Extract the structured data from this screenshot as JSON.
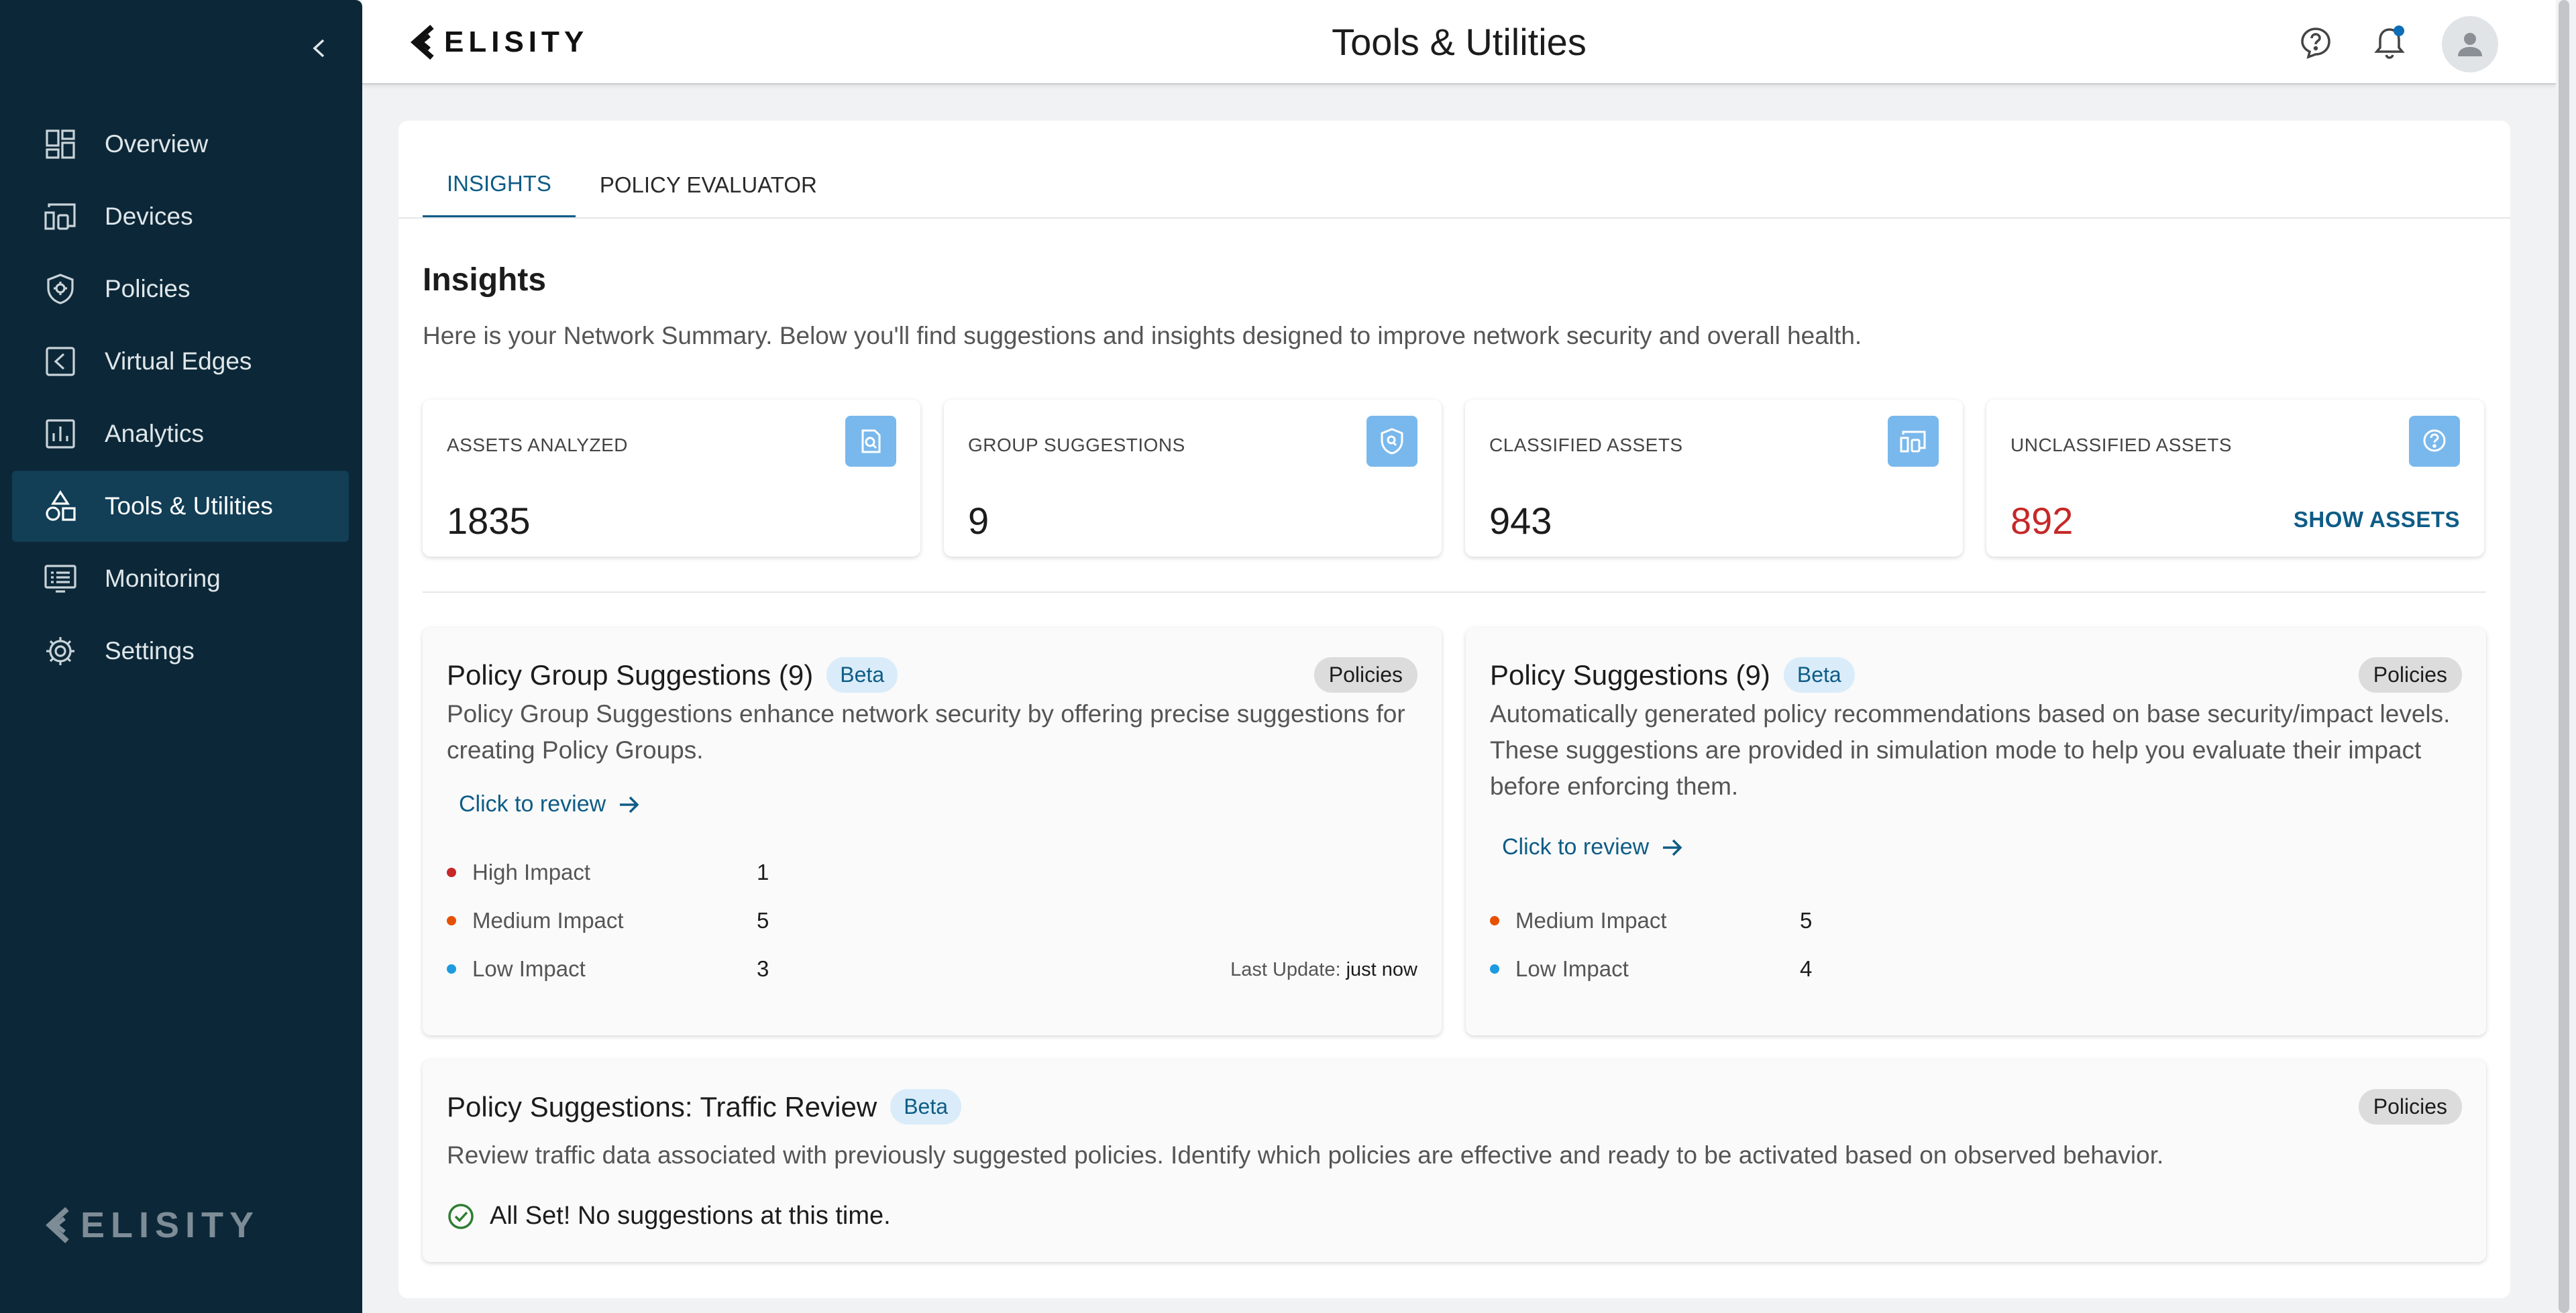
{
  "app": {
    "brand": "ELISITY",
    "page_title": "Tools & Utilities"
  },
  "colors": {
    "sidebar": "#0c2838",
    "accent": "#0e5c86",
    "high": "#c62828",
    "medium": "#e65100",
    "low": "#1e9be0",
    "success": "#2e7d32"
  },
  "sidebar": {
    "items": [
      {
        "label": "Overview",
        "icon": "dashboard-icon"
      },
      {
        "label": "Devices",
        "icon": "devices-icon"
      },
      {
        "label": "Policies",
        "icon": "shield-icon"
      },
      {
        "label": "Virtual Edges",
        "icon": "virtual-edge-icon"
      },
      {
        "label": "Analytics",
        "icon": "bar-chart-icon"
      },
      {
        "label": "Tools & Utilities",
        "icon": "shapes-icon",
        "active": true
      },
      {
        "label": "Monitoring",
        "icon": "monitor-icon"
      },
      {
        "label": "Settings",
        "icon": "gear-icon"
      }
    ],
    "logo": "ELISITY"
  },
  "tabs": [
    {
      "label": "INSIGHTS",
      "active": true
    },
    {
      "label": "POLICY EVALUATOR"
    }
  ],
  "insights": {
    "title": "Insights",
    "description": "Here is your Network Summary. Below you'll find suggestions and insights designed to improve network security and overall health."
  },
  "stats": [
    {
      "label": "ASSETS ANALYZED",
      "value": "1835",
      "icon": "asset-search-icon"
    },
    {
      "label": "GROUP SUGGESTIONS",
      "value": "9",
      "icon": "shield-search-icon"
    },
    {
      "label": "CLASSIFIED ASSETS",
      "value": "943",
      "icon": "devices-icon"
    },
    {
      "label": "UNCLASSIFIED ASSETS",
      "value": "892",
      "icon": "help-circle-icon",
      "action": "SHOW ASSETS"
    }
  ],
  "policy_group_suggestions": {
    "title": "Policy Group Suggestions (9)",
    "badge": "Beta",
    "chip": "Policies",
    "description": "Policy Group Suggestions enhance network security by offering precise suggestions for creating Policy Groups.",
    "review": "Click to review",
    "impacts": [
      {
        "label": "High Impact",
        "value": "1",
        "level": "high"
      },
      {
        "label": "Medium Impact",
        "value": "5",
        "level": "medium"
      },
      {
        "label": "Low Impact",
        "value": "3",
        "level": "low"
      }
    ],
    "last_update_label": "Last Update:",
    "last_update_value": "just now"
  },
  "policy_suggestions": {
    "title": "Policy Suggestions (9)",
    "badge": "Beta",
    "chip": "Policies",
    "description": "Automatically generated policy recommendations based on base security/impact levels. These suggestions are provided in simulation mode to help you evaluate their impact before enforcing them.",
    "review": "Click to review",
    "impacts": [
      {
        "label": "Medium Impact",
        "value": "5",
        "level": "medium"
      },
      {
        "label": "Low Impact",
        "value": "4",
        "level": "low"
      }
    ]
  },
  "traffic_review": {
    "title": "Policy Suggestions: Traffic Review",
    "badge": "Beta",
    "chip": "Policies",
    "description": "Review traffic data associated with previously suggested policies. Identify which policies are effective and ready to be activated based on observed behavior.",
    "status": "All Set! No suggestions at this time."
  }
}
